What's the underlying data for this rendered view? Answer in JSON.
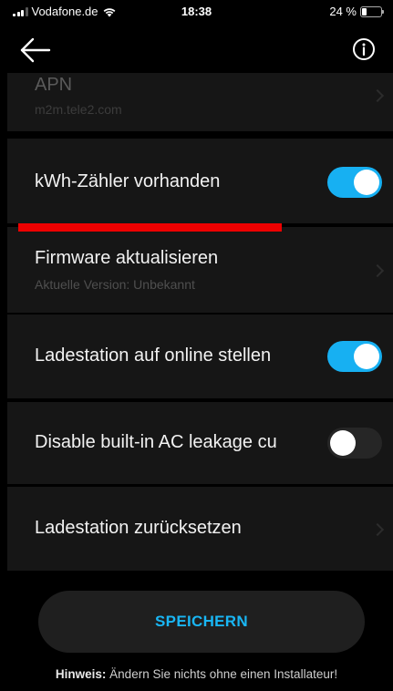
{
  "status_bar": {
    "carrier": "Vodafone.de",
    "time": "18:38",
    "battery": "24 %",
    "battery_level": 0.24
  },
  "nav": {
    "back_icon": "arrow-left-icon",
    "info_icon": "info-icon"
  },
  "settings": {
    "apn": {
      "label": "APN",
      "value": "m2m.tele2.com"
    },
    "kwh_meter": {
      "label": "kWh-Zähler vorhanden",
      "enabled": true
    },
    "firmware": {
      "label": "Firmware aktualisieren",
      "sublabel": "Aktuelle Version: Unbekannt"
    },
    "online": {
      "label": "Ladestation auf online stellen",
      "enabled": true
    },
    "ac_leakage": {
      "label": "Disable built-in AC leakage cu",
      "enabled": false
    },
    "reset": {
      "label": "Ladestation zurücksetzen"
    }
  },
  "save_button": {
    "label": "SPEICHERN"
  },
  "hint": {
    "prefix": "Hinweis:",
    "text": " Ändern Sie nichts ohne einen Installateur!"
  },
  "colors": {
    "accent": "#17b0f2",
    "annotation_red": "#ee0000",
    "card_background": "#161616"
  }
}
